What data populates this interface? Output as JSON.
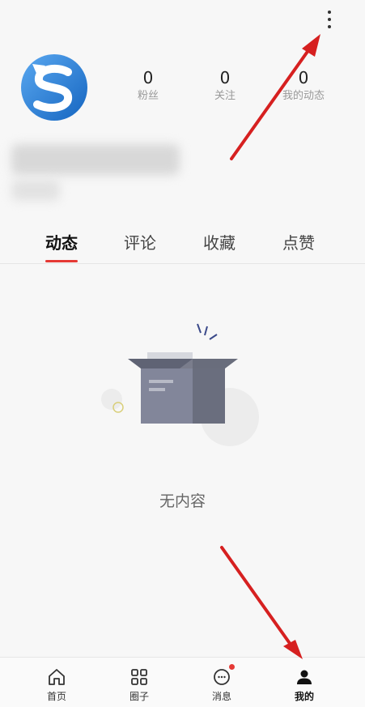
{
  "header": {
    "more_icon": "more-vertical-icon"
  },
  "profile": {
    "avatar_icon": "app-logo-s",
    "stats": [
      {
        "value": "0",
        "label": "粉丝"
      },
      {
        "value": "0",
        "label": "关注"
      },
      {
        "value": "0",
        "label": "我的动态"
      }
    ]
  },
  "tabs": [
    {
      "label": "动态"
    },
    {
      "label": "评论"
    },
    {
      "label": "收藏"
    },
    {
      "label": "点赞"
    }
  ],
  "empty": {
    "text": "无内容",
    "icon": "empty-box-icon"
  },
  "bottom_nav": [
    {
      "label": "首页",
      "icon": "home-icon"
    },
    {
      "label": "圈子",
      "icon": "grid-icon"
    },
    {
      "label": "消息",
      "icon": "message-icon"
    },
    {
      "label": "我的",
      "icon": "user-icon"
    }
  ],
  "colors": {
    "accent": "#e53935",
    "avatar_blue": "#1e88e5"
  }
}
